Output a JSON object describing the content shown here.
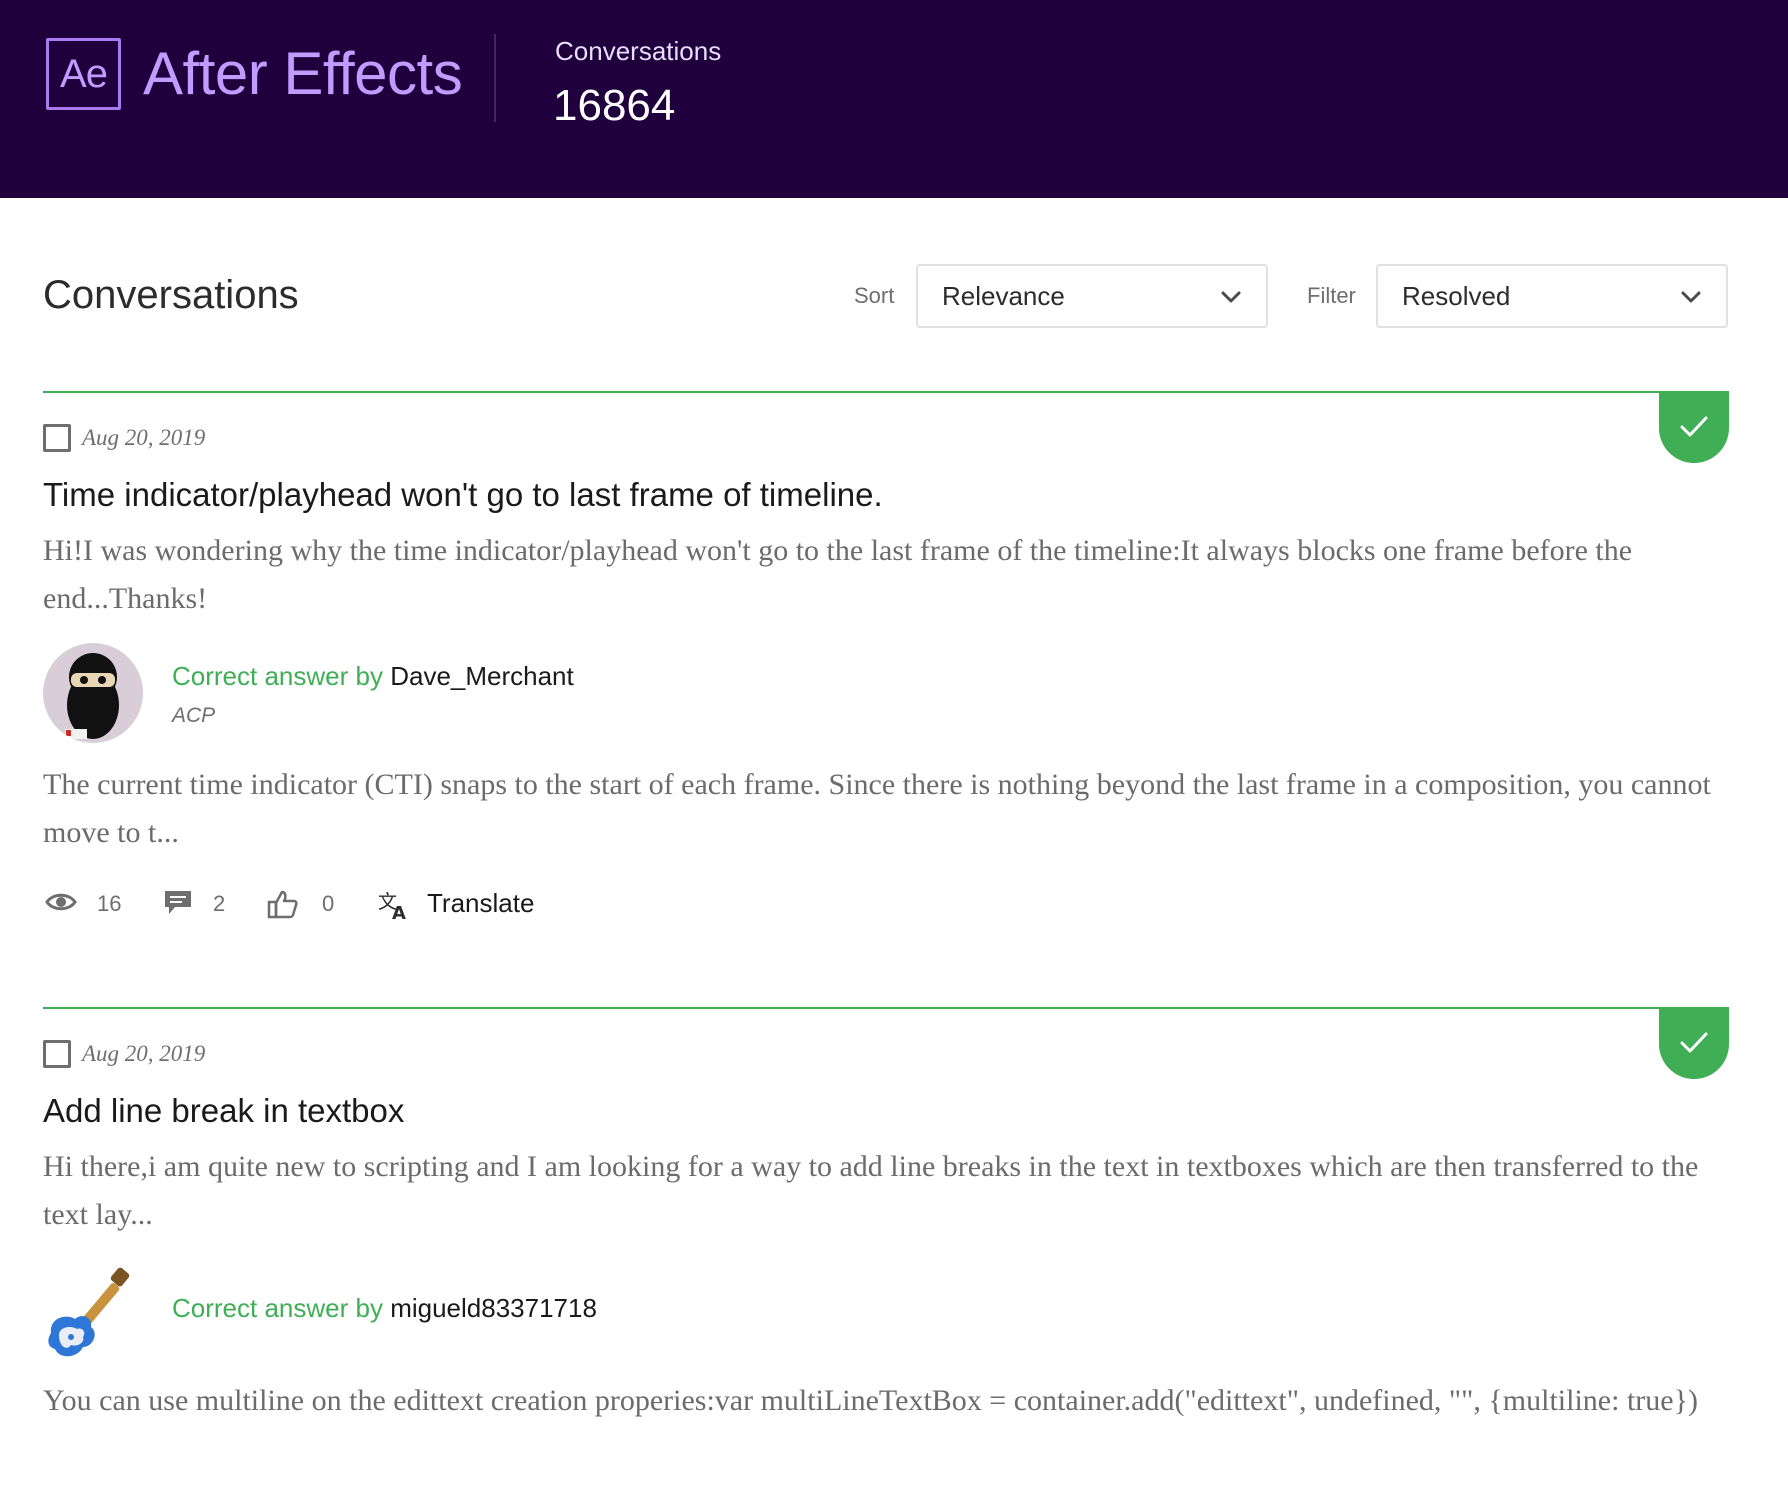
{
  "header": {
    "logo_text": "Ae",
    "app_name": "After Effects",
    "stat_label": "Conversations",
    "stat_value": "16864"
  },
  "toolbar": {
    "title": "Conversations",
    "sort_label": "Sort",
    "sort_value": "Relevance",
    "filter_label": "Filter",
    "filter_value": "Resolved"
  },
  "posts": [
    {
      "date": "Aug 20, 2019",
      "title": "Time indicator/playhead won't go to last frame of timeline.",
      "excerpt": "Hi!I was wondering why the time indicator/playhead won't go to the last frame of the timeline:It always blocks one frame before the end...Thanks!",
      "answer_prefix": "Correct answer by",
      "answer_author": "Dave_Merchant",
      "answer_rank": "ACP",
      "answer_excerpt": "The current time indicator (CTI) snaps to the start of each frame. Since there is nothing beyond the last frame in a composition, you cannot move to t...",
      "views": "16",
      "replies": "2",
      "likes": "0",
      "translate_label": "Translate"
    },
    {
      "date": "Aug 20, 2019",
      "title": "Add line break in textbox",
      "excerpt": "Hi there,i am quite new to scripting and I am looking for a way to add line breaks in the text in textboxes which are then transferred to the text lay...",
      "answer_prefix": "Correct answer by",
      "answer_author": "migueld83371718",
      "answer_excerpt": "You can use multiline on the edittext creation properies:var multiLineTextBox = container.add(\"edittext\", undefined, \"\", {multiline: true})"
    }
  ],
  "colors": {
    "header_bg": "#1f003d",
    "brand_purple": "#c39bff",
    "resolved_green": "#3fae55"
  },
  "icons": [
    "eye-icon",
    "comment-icon",
    "thumbs-up-icon",
    "translate-icon",
    "check-icon",
    "chevron-down-icon"
  ]
}
